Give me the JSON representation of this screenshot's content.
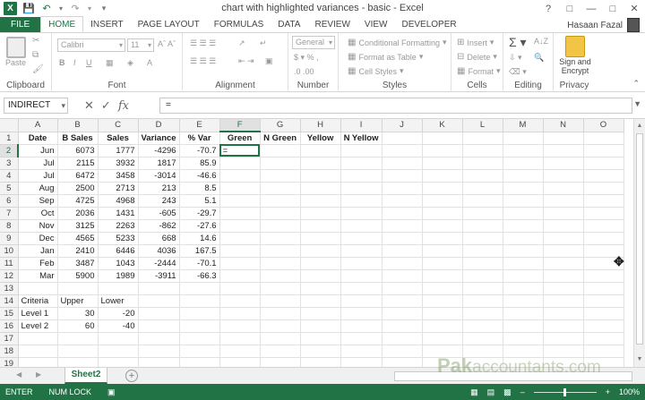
{
  "window": {
    "title": "chart with highlighted variances - basic - Excel",
    "user": "Hasaan Fazal"
  },
  "ribbon_tabs": [
    "FILE",
    "HOME",
    "INSERT",
    "PAGE LAYOUT",
    "FORMULAS",
    "DATA",
    "REVIEW",
    "VIEW",
    "DEVELOPER"
  ],
  "ribbon": {
    "clipboard": {
      "label": "Clipboard",
      "paste": "Paste"
    },
    "font": {
      "label": "Font",
      "name": "Calibri",
      "size": "11"
    },
    "alignment": {
      "label": "Alignment"
    },
    "number": {
      "label": "Number",
      "format": "General"
    },
    "styles": {
      "label": "Styles",
      "cond": "Conditional Formatting",
      "table": "Format as Table",
      "cell": "Cell Styles"
    },
    "cells": {
      "label": "Cells",
      "insert": "Insert",
      "delete": "Delete",
      "format": "Format"
    },
    "editing": {
      "label": "Editing"
    },
    "privacy": {
      "label": "Privacy",
      "sign": "Sign and",
      "encrypt": "Encrypt"
    }
  },
  "formula_bar": {
    "name_box": "INDIRECT",
    "formula": "="
  },
  "columns": [
    "A",
    "B",
    "C",
    "D",
    "E",
    "F",
    "G",
    "H",
    "I",
    "J",
    "K",
    "L",
    "M",
    "N",
    "O"
  ],
  "rows": [
    [
      "Date",
      "B Sales",
      "Sales",
      "Variance",
      "% Var",
      "Green",
      "N Green",
      "Yellow",
      "N Yellow",
      "",
      "",
      "",
      "",
      "",
      ""
    ],
    [
      "Jun",
      "6073",
      "1777",
      "-4296",
      "-70.7",
      "=",
      "",
      "",
      "",
      "",
      "",
      "",
      "",
      "",
      ""
    ],
    [
      "Jul",
      "2115",
      "3932",
      "1817",
      "85.9",
      "",
      "",
      "",
      "",
      "",
      "",
      "",
      "",
      "",
      ""
    ],
    [
      "Jul",
      "6472",
      "3458",
      "-3014",
      "-46.6",
      "",
      "",
      "",
      "",
      "",
      "",
      "",
      "",
      "",
      ""
    ],
    [
      "Aug",
      "2500",
      "2713",
      "213",
      "8.5",
      "",
      "",
      "",
      "",
      "",
      "",
      "",
      "",
      "",
      ""
    ],
    [
      "Sep",
      "4725",
      "4968",
      "243",
      "5.1",
      "",
      "",
      "",
      "",
      "",
      "",
      "",
      "",
      "",
      ""
    ],
    [
      "Oct",
      "2036",
      "1431",
      "-605",
      "-29.7",
      "",
      "",
      "",
      "",
      "",
      "",
      "",
      "",
      "",
      ""
    ],
    [
      "Nov",
      "3125",
      "2263",
      "-862",
      "-27.6",
      "",
      "",
      "",
      "",
      "",
      "",
      "",
      "",
      "",
      ""
    ],
    [
      "Dec",
      "4565",
      "5233",
      "668",
      "14.6",
      "",
      "",
      "",
      "",
      "",
      "",
      "",
      "",
      "",
      ""
    ],
    [
      "Jan",
      "2410",
      "6446",
      "4036",
      "167.5",
      "",
      "",
      "",
      "",
      "",
      "",
      "",
      "",
      "",
      ""
    ],
    [
      "Feb",
      "3487",
      "1043",
      "-2444",
      "-70.1",
      "",
      "",
      "",
      "",
      "",
      "",
      "",
      "",
      "",
      ""
    ],
    [
      "Mar",
      "5900",
      "1989",
      "-3911",
      "-66.3",
      "",
      "",
      "",
      "",
      "",
      "",
      "",
      "",
      "",
      ""
    ],
    [
      "",
      "",
      "",
      "",
      "",
      "",
      "",
      "",
      "",
      "",
      "",
      "",
      "",
      "",
      ""
    ],
    [
      "Criteria",
      "Upper",
      "Lower",
      "",
      "",
      "",
      "",
      "",
      "",
      "",
      "",
      "",
      "",
      "",
      ""
    ],
    [
      "Level 1",
      "30",
      "-20",
      "",
      "",
      "",
      "",
      "",
      "",
      "",
      "",
      "",
      "",
      "",
      ""
    ],
    [
      "Level 2",
      "60",
      "-40",
      "",
      "",
      "",
      "",
      "",
      "",
      "",
      "",
      "",
      "",
      "",
      ""
    ],
    [
      "",
      "",
      "",
      "",
      "",
      "",
      "",
      "",
      "",
      "",
      "",
      "",
      "",
      "",
      ""
    ],
    [
      "",
      "",
      "",
      "",
      "",
      "",
      "",
      "",
      "",
      "",
      "",
      "",
      "",
      "",
      ""
    ],
    [
      "",
      "",
      "",
      "",
      "",
      "",
      "",
      "",
      "",
      "",
      "",
      "",
      "",
      "",
      ""
    ]
  ],
  "sheet_tabs": [
    "Sheet2"
  ],
  "status": {
    "mode": "ENTER",
    "numlock": "NUM LOCK",
    "zoom": "100%"
  },
  "watermark": {
    "main": "Pak",
    "rest": "accountants.com"
  },
  "colors": {
    "accent": "#217346"
  }
}
